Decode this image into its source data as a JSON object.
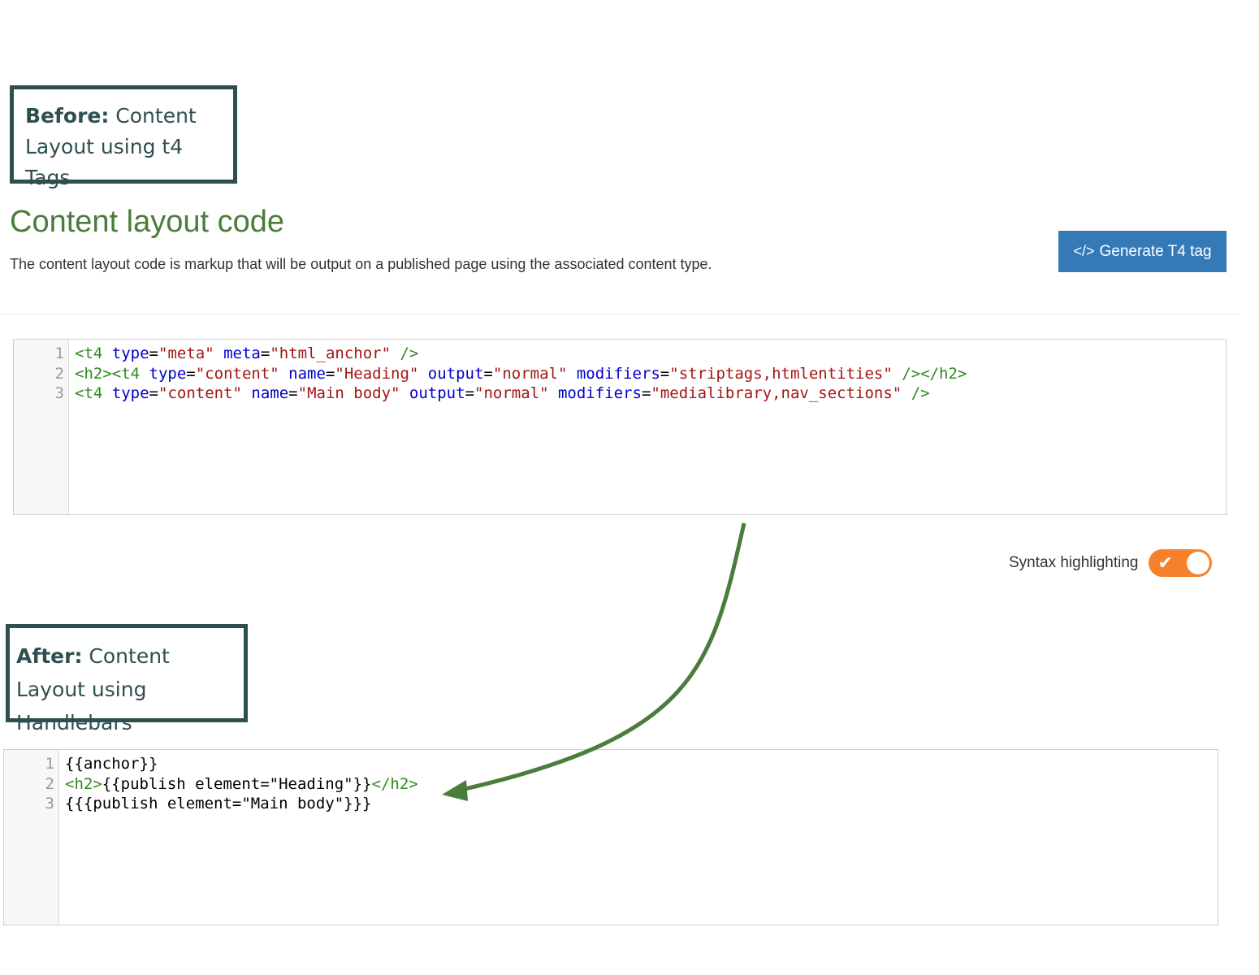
{
  "before_callout": {
    "strong": "Before:",
    "text": " Content Layout using t4 Tags"
  },
  "section": {
    "title": "Content layout code",
    "description": "The content layout code is markup that will be output on a published page using the associated content type."
  },
  "generate_button": {
    "icon": "</>",
    "label": "Generate T4 tag",
    "color": "#337ab7"
  },
  "before_editor": {
    "line_numbers": [
      "1",
      "2",
      "3"
    ],
    "lines": [
      [
        {
          "t": "tg",
          "v": "<t4"
        },
        {
          "t": "pl",
          "v": " "
        },
        {
          "t": "at",
          "v": "type"
        },
        {
          "t": "pl",
          "v": "="
        },
        {
          "t": "vl",
          "v": "\"meta\""
        },
        {
          "t": "pl",
          "v": " "
        },
        {
          "t": "at",
          "v": "meta"
        },
        {
          "t": "pl",
          "v": "="
        },
        {
          "t": "vl",
          "v": "\"html_anchor\""
        },
        {
          "t": "pl",
          "v": " "
        },
        {
          "t": "tg",
          "v": "/>"
        }
      ],
      [
        {
          "t": "tg",
          "v": "<h2><t4"
        },
        {
          "t": "pl",
          "v": " "
        },
        {
          "t": "at",
          "v": "type"
        },
        {
          "t": "pl",
          "v": "="
        },
        {
          "t": "vl",
          "v": "\"content\""
        },
        {
          "t": "pl",
          "v": " "
        },
        {
          "t": "at",
          "v": "name"
        },
        {
          "t": "pl",
          "v": "="
        },
        {
          "t": "vl",
          "v": "\"Heading\""
        },
        {
          "t": "pl",
          "v": " "
        },
        {
          "t": "at",
          "v": "output"
        },
        {
          "t": "pl",
          "v": "="
        },
        {
          "t": "vl",
          "v": "\"normal\""
        },
        {
          "t": "pl",
          "v": " "
        },
        {
          "t": "at",
          "v": "modifiers"
        },
        {
          "t": "pl",
          "v": "="
        },
        {
          "t": "vl",
          "v": "\"striptags,htmlentities\""
        },
        {
          "t": "pl",
          "v": " "
        },
        {
          "t": "tg",
          "v": "/></h2>"
        }
      ],
      [
        {
          "t": "tg",
          "v": "<t4"
        },
        {
          "t": "pl",
          "v": " "
        },
        {
          "t": "at",
          "v": "type"
        },
        {
          "t": "pl",
          "v": "="
        },
        {
          "t": "vl",
          "v": "\"content\""
        },
        {
          "t": "pl",
          "v": " "
        },
        {
          "t": "at",
          "v": "name"
        },
        {
          "t": "pl",
          "v": "="
        },
        {
          "t": "vl",
          "v": "\"Main body\""
        },
        {
          "t": "pl",
          "v": " "
        },
        {
          "t": "at",
          "v": "output"
        },
        {
          "t": "pl",
          "v": "="
        },
        {
          "t": "vl",
          "v": "\"normal\""
        },
        {
          "t": "pl",
          "v": " "
        },
        {
          "t": "at",
          "v": "modifiers"
        },
        {
          "t": "pl",
          "v": "="
        },
        {
          "t": "vl",
          "v": "\"medialibrary,nav_sections\""
        },
        {
          "t": "pl",
          "v": " "
        },
        {
          "t": "tg",
          "v": "/>"
        }
      ]
    ]
  },
  "syntax_highlighting": {
    "label": "Syntax highlighting",
    "enabled": true,
    "color": "#f5822a"
  },
  "after_callout": {
    "strong": "After:",
    "text": " Content Layout using Handlebars"
  },
  "after_editor": {
    "line_numbers": [
      "1",
      "2",
      "3"
    ],
    "lines": [
      [
        {
          "t": "pl",
          "v": "{{anchor}}"
        }
      ],
      [
        {
          "t": "tg",
          "v": "<h2>"
        },
        {
          "t": "pl",
          "v": "{{publish element=\"Heading\"}}"
        },
        {
          "t": "tg",
          "v": "</h2>"
        }
      ],
      [
        {
          "t": "pl",
          "v": "{{{publish element=\"Main body\"}}}"
        }
      ]
    ]
  },
  "arrow_color": "#4a7c3c"
}
